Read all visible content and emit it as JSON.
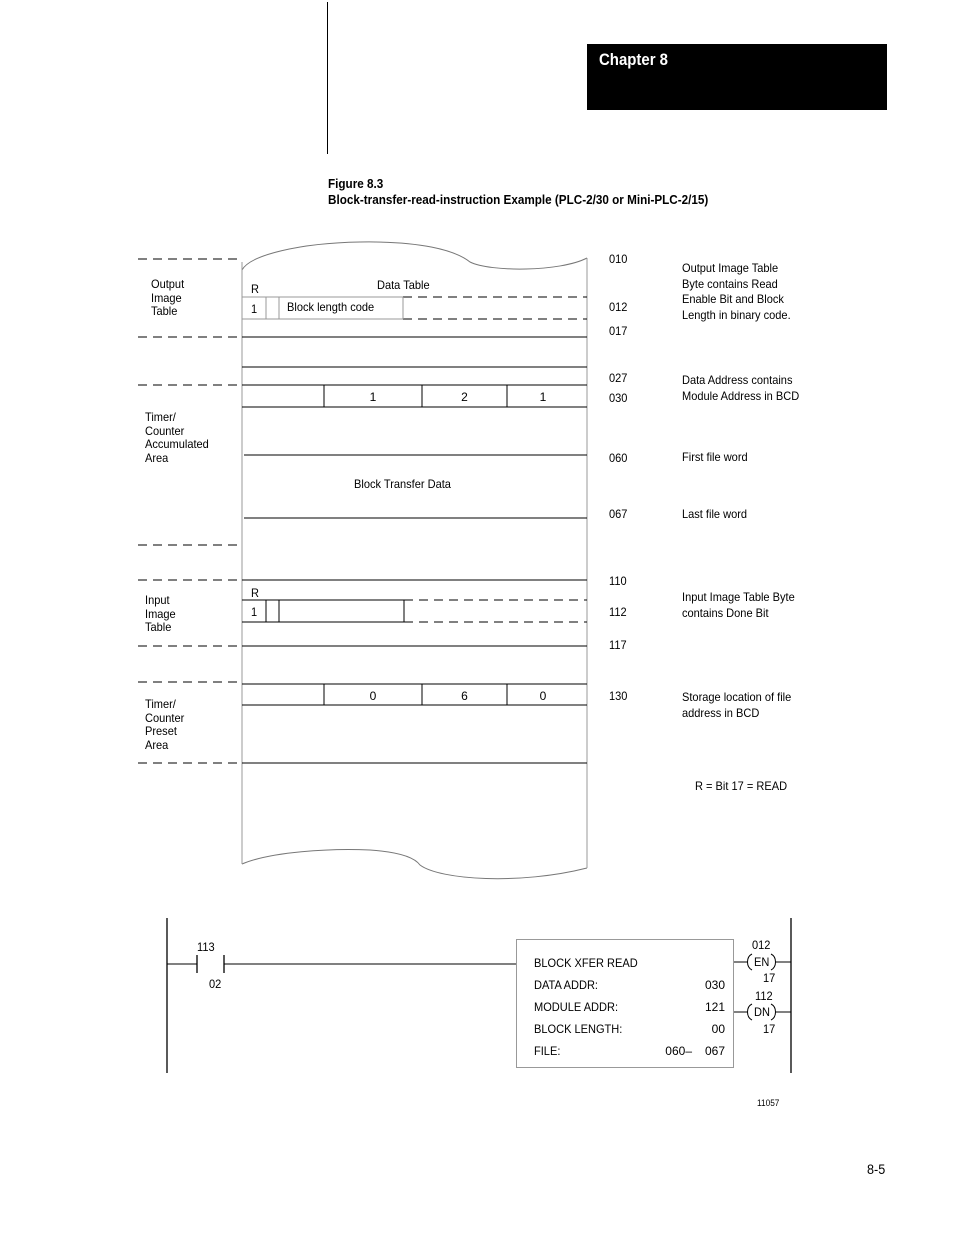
{
  "header": {
    "chapter_label": "Chapter 8"
  },
  "figure": {
    "number": "Figure 8.3",
    "title": "Block-transfer-read-instruction Example (PLC-2/30 or Mini-PLC-2/15)",
    "id": "11057"
  },
  "data_table": {
    "title": "Data Table",
    "sections": {
      "output_image": {
        "label": "Output\nImage\nTable",
        "bit_label": "R",
        "bit_value": "1",
        "field_label": "Block length code",
        "addresses": [
          "010",
          "012",
          "017"
        ],
        "description": "Output Image Table\nByte contains Read\nEnable Bit and Block\nLength in binary code."
      },
      "timer_acc": {
        "label": "Timer/\nCounter\nAccumulated\nArea",
        "bcd_digits": [
          "1",
          "2",
          "1"
        ],
        "block_label": "Block Transfer Data",
        "addresses": [
          "027",
          "030",
          "060",
          "067"
        ],
        "descriptions": {
          "data_addr": "Data Address contains\nModule Address in BCD",
          "first": "First file word",
          "last": "Last file word"
        }
      },
      "input_image": {
        "label": "Input\nImage\nTable",
        "bit_label": "R",
        "bit_value": "1",
        "addresses": [
          "110",
          "112",
          "117"
        ],
        "description": "Input Image Table Byte\ncontains Done Bit"
      },
      "timer_preset": {
        "label": "Timer/\nCounter\nPreset\nArea",
        "bcd_digits": [
          "0",
          "6",
          "0"
        ],
        "addresses": [
          "130"
        ],
        "description": "Storage location of file\naddress in BCD"
      }
    },
    "legend": "R = Bit 17 = READ"
  },
  "ladder": {
    "contact": {
      "word": "113",
      "bit": "02"
    },
    "instruction": {
      "title": "BLOCK XFER READ",
      "rows": [
        {
          "label": "DATA ADDR:",
          "value": "030"
        },
        {
          "label": "MODULE ADDR:",
          "value": "121"
        },
        {
          "label": "BLOCK LENGTH:",
          "value": "00"
        },
        {
          "label": "FILE:",
          "prefix": "060–",
          "value": "067"
        }
      ]
    },
    "outputs": [
      {
        "word": "012",
        "name": "EN",
        "bit": "17"
      },
      {
        "word": "112",
        "name": "DN",
        "bit": "17"
      }
    ]
  },
  "footer": {
    "page_number": "8-5"
  }
}
